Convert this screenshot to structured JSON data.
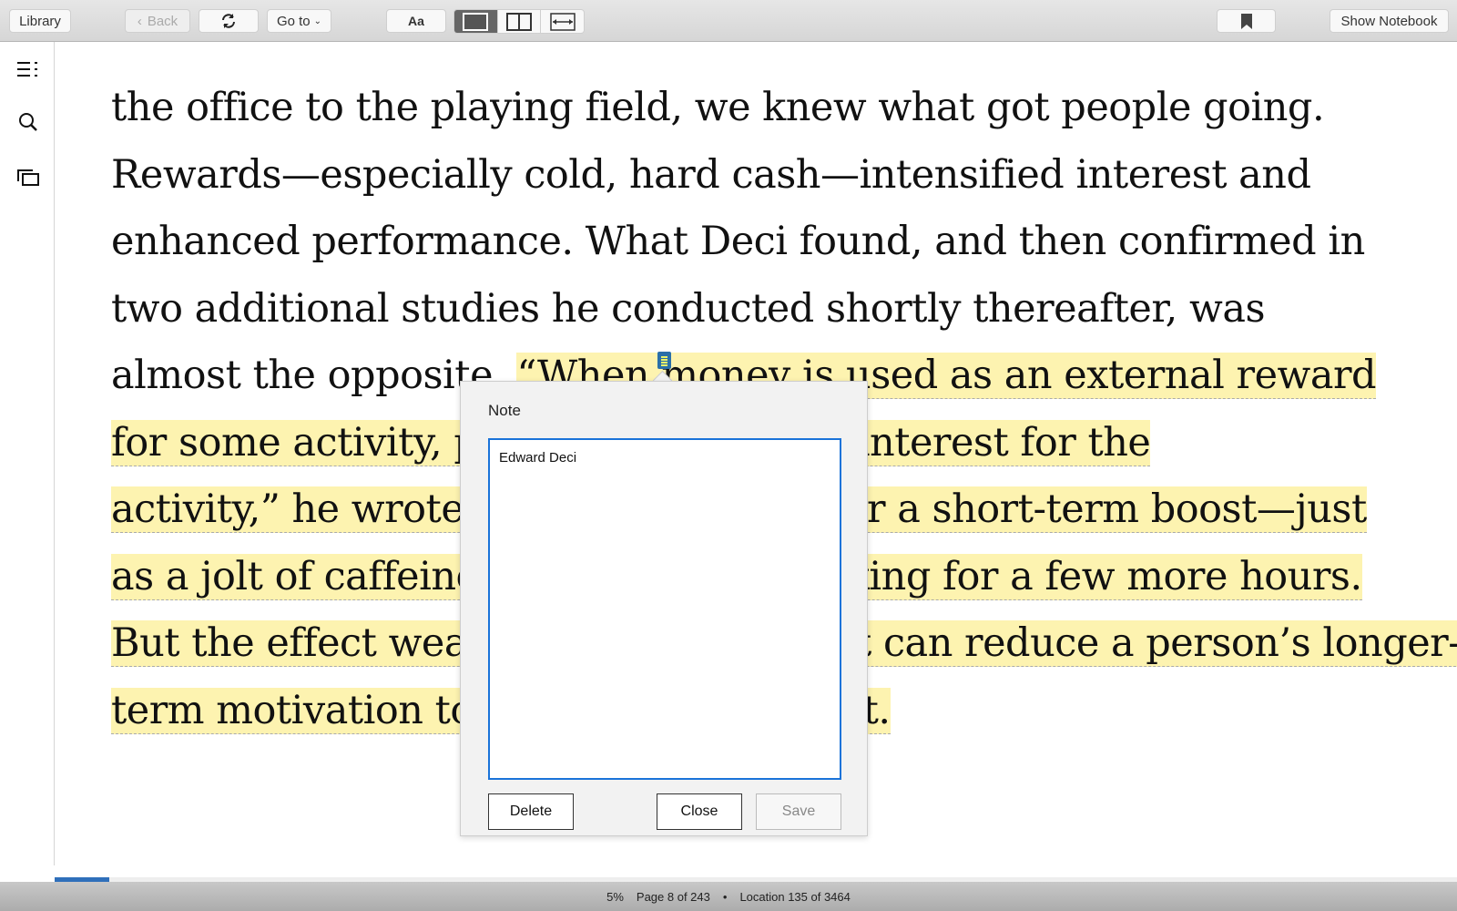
{
  "toolbar": {
    "library_label": "Library",
    "back_label": "Back",
    "goto_label": "Go to",
    "font_label": "Aa",
    "show_notebook_label": "Show Notebook"
  },
  "sidebar": {
    "icons": [
      "table-of-contents-icon",
      "search-icon",
      "flashcards-icon"
    ]
  },
  "book": {
    "lines": [
      {
        "plain": "the office to the playing field, we knew what got people going.",
        "hl": ""
      },
      {
        "plain": "Rewards—especially cold, hard cash—intensified interest and",
        "hl": ""
      },
      {
        "plain": "enhanced performance. What Deci found, and then confirmed in",
        "hl": ""
      },
      {
        "plain": "two additional studies he conducted shortly thereafter, was",
        "hl": ""
      },
      {
        "plain": "almost the opposite. ",
        "hl": "“When money is used as an external reward"
      },
      {
        "plain": "",
        "hl": "for some activity, people lose intrinsic interest for the"
      },
      {
        "plain": "",
        "hl": "activity,” he wrote. Rewards can deliver a short-term boost—just"
      },
      {
        "plain": "",
        "hl": "as a jolt of caffeine can keep you cranking for a few more hours."
      },
      {
        "plain": "",
        "hl": "But the effect wears off—and, worse, it can reduce a person’s longer-"
      },
      {
        "plain": "",
        "hl": "term motivation to continue the project."
      }
    ]
  },
  "note": {
    "title": "Note",
    "text": "Edward Deci",
    "delete_label": "Delete",
    "close_label": "Close",
    "save_label": "Save"
  },
  "status": {
    "percent": "5%",
    "page": "Page 8 of 243",
    "separator": "•",
    "location": "Location 135 of 3464",
    "progress": 0.05
  },
  "colors": {
    "highlight": "#fdf3b0",
    "accent": "#1a73d9",
    "progress": "#2f6fba"
  }
}
